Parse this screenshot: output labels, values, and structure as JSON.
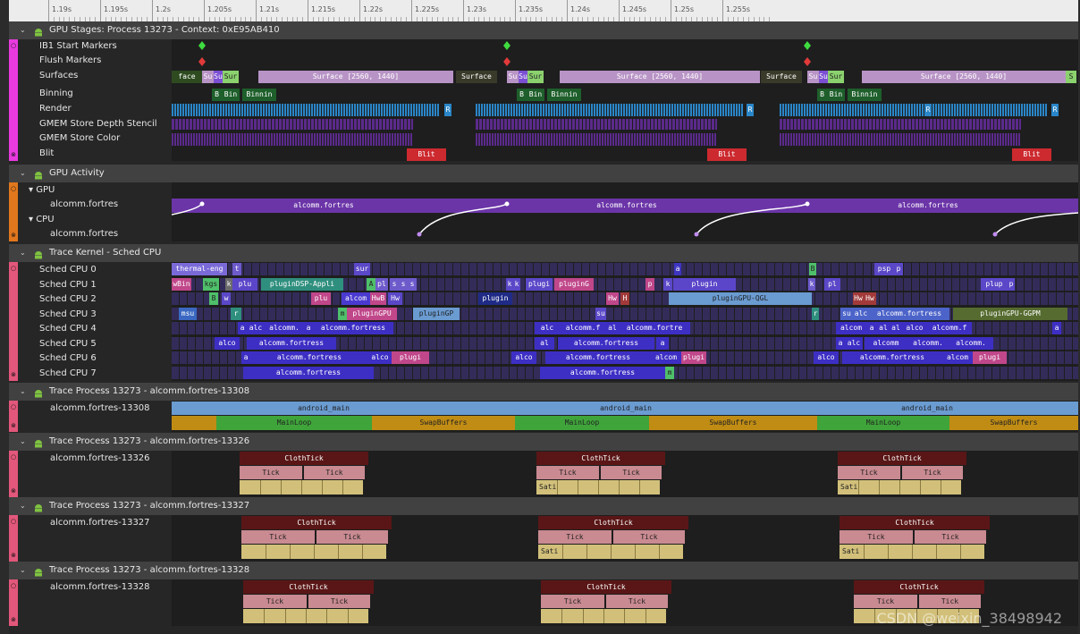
{
  "ruler": {
    "ticks": [
      "1.19s",
      "1.195s",
      "1.2s",
      "1.205s",
      "1.21s",
      "1.215s",
      "1.22s",
      "1.225s",
      "1.23s",
      "1.235s",
      "1.24s",
      "1.245s",
      "1.25s",
      "1.255s"
    ]
  },
  "sections": {
    "gpu_stages": {
      "title": "GPU Stages: Process 13273 - Context: 0xE95AB410",
      "tracks": [
        "IB1 Start Markers",
        "Flush Markers",
        "Surfaces",
        "Binning",
        "Render",
        "GMEM Store Depth Stencil",
        "GMEM Store Color",
        "Blit"
      ]
    },
    "gpu_activity": {
      "title": "GPU Activity",
      "gpu_group": "GPU",
      "gpu_track": "alcomm.fortres",
      "cpu_group": "CPU",
      "cpu_track": "alcomm.fortres"
    },
    "sched": {
      "title": "Trace Kernel - Sched CPU",
      "tracks": [
        "Sched CPU 0",
        "Sched CPU 1",
        "Sched CPU 2",
        "Sched CPU 3",
        "Sched CPU 4",
        "Sched CPU 5",
        "Sched CPU 6",
        "Sched CPU 7"
      ]
    },
    "p13308": {
      "title": "Trace Process 13273 - alcomm.fortres-13308",
      "track": "alcomm.fortres-13308"
    },
    "p13326": {
      "title": "Trace Process 13273 - alcomm.fortres-13326",
      "track": "alcomm.fortres-13326"
    },
    "p13327": {
      "title": "Trace Process 13273 - alcomm.fortres-13327",
      "track": "alcomm.fortres-13327"
    },
    "p13328": {
      "title": "Trace Process 13273 - alcomm.fortres-13328",
      "track": "alcomm.fortres-13328"
    }
  },
  "slice_labels": {
    "surface_full": "Surface  [2560, 1440]",
    "surface": "Surface",
    "face": "face",
    "su": "Su",
    "sur": "Sur",
    "binnin": "Binnin",
    "bin": "Bin",
    "bi": "Bi",
    "b": "B",
    "r": "R",
    "blit": "Blit",
    "gpu_slice": "alcomm.fortres",
    "android_main": "android_main",
    "mainloop": "MainLoop",
    "swapbuffers": "SwapBuffers",
    "clothtick": "ClothTick",
    "tick": "Tick",
    "sati": "Sati",
    "s": "S"
  },
  "sched_labels": {
    "cpu0": [
      "thermal-eng",
      "t",
      "sur",
      "a",
      "B",
      "psp",
      "p"
    ],
    "cpu1": [
      "wBin",
      "kgs",
      "k",
      "plu",
      "pluginDSP-Appli",
      "A",
      "pl",
      "s",
      "s",
      "s",
      "k",
      "k",
      "plugi",
      "pluginG",
      "p",
      "k",
      "plugin",
      "k",
      "pl",
      "plup",
      "p"
    ],
    "cpu2": [
      "B",
      "w",
      "plu",
      "alcom",
      "HwB",
      "Hw",
      "plugin",
      "Hw",
      "H",
      "pluginGPU-QGL",
      "Hw",
      "Hw"
    ],
    "cpu3": [
      "msu",
      "r",
      "m",
      "pluginGPU",
      "pluginGP",
      "su",
      "r",
      "su",
      "alc",
      "alcomm.fortress",
      "pluginGPU-GGPM"
    ],
    "cpu4": [
      "a",
      "alc",
      "alcomm.",
      "a",
      "alcomm.fortress",
      "alc",
      "alcomm.f",
      "al",
      "alcomm.fortre",
      "alcom",
      "a",
      "al",
      "al",
      "alco",
      "alcomm.f",
      "a"
    ],
    "cpu5": [
      "alco",
      "alcomm.fortress",
      "al",
      "alcomm.fortress",
      "a",
      "a",
      "alc",
      "alcomm",
      "alcomm.",
      "alcomm."
    ],
    "cpu6": [
      "a",
      "alcomm.fortress",
      "alco",
      "plugi",
      "alco",
      "alcomm.fortress",
      "alcom",
      "plugi",
      "alco",
      "alcomm.fortress",
      "alcom",
      "plugi"
    ],
    "cpu7": [
      "alcomm.fortress",
      "alcomm.fortress",
      "m"
    ]
  },
  "colors": {
    "accent_magenta": "#e83adf",
    "accent_orange": "#e0771d",
    "accent_pink": "#e2577b",
    "surface": "#b894c6",
    "binning": "#1e5f2b",
    "render": "#2a86c8",
    "gmem": "#5b2a8c",
    "blit": "#cc2a2f",
    "gpu_activity": "#6b35a8",
    "android_main": "#6a9bd1",
    "mainloop": "#3fa43a",
    "swapbuffers": "#c08c14",
    "clothtick": "#5a1616",
    "tick": "#c98a91",
    "sati": "#d2c07a"
  },
  "watermark": "CSDN @weixin_38498942"
}
